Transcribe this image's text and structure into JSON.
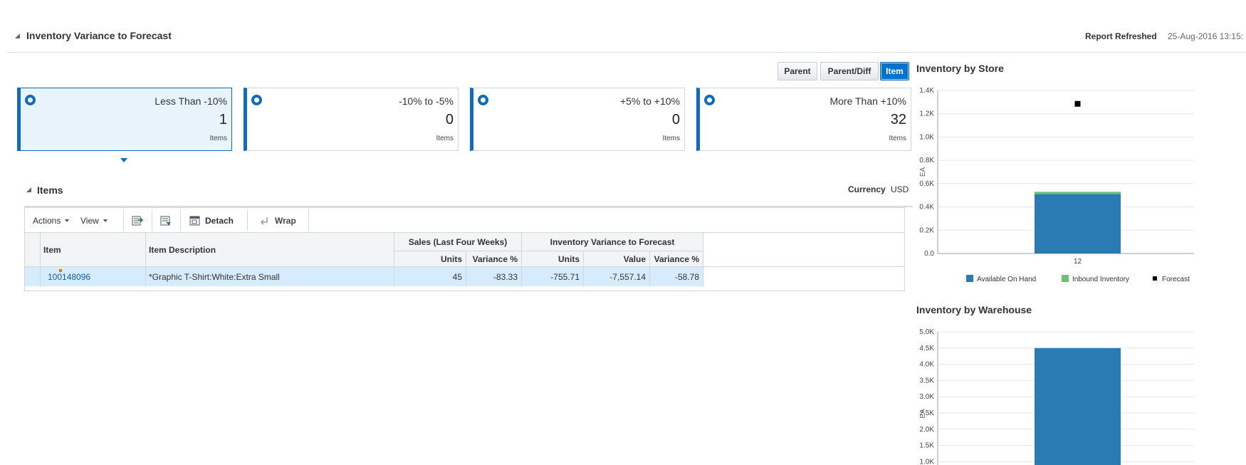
{
  "header": {
    "title": "Inventory Variance to Forecast",
    "refresh_label": "Report Refreshed",
    "refresh_date": "25-Aug-2016 13:15:"
  },
  "view_buttons": [
    {
      "label": "Parent",
      "active": false
    },
    {
      "label": "Parent/Diff",
      "active": false
    },
    {
      "label": "Item",
      "active": true
    }
  ],
  "tiles": [
    {
      "label": "Less Than -10%",
      "count": "1",
      "unit": "Items",
      "selected": true
    },
    {
      "label": "-10% to -5%",
      "count": "0",
      "unit": "Items",
      "selected": false
    },
    {
      "label": "+5% to +10%",
      "count": "0",
      "unit": "Items",
      "selected": false
    },
    {
      "label": "More Than +10%",
      "count": "32",
      "unit": "Items",
      "selected": false
    }
  ],
  "items_panel": {
    "title": "Items",
    "currency_label": "Currency",
    "currency_value": "USD",
    "toolbar": {
      "actions": "Actions",
      "view": "View",
      "detach": "Detach",
      "wrap": "Wrap"
    },
    "columns": {
      "item": "Item",
      "description": "Item Description",
      "sales_group": "Sales (Last Four Weeks)",
      "sales_units": "Units",
      "sales_variance": "Variance %",
      "inv_group": "Inventory Variance to Forecast",
      "inv_units": "Units",
      "inv_value": "Value",
      "inv_variance": "Variance %"
    },
    "rows": [
      {
        "item": "100148096",
        "description": "*Graphic T-Shirt:White:Extra Small",
        "sales_units": "45",
        "sales_variance": "-83.33",
        "inv_units": "-755.71",
        "inv_value": "-7,557.14",
        "inv_variance": "-58.78"
      }
    ]
  },
  "colors": {
    "accent": "#0f6cbd",
    "available_on_hand": "#2a7ab4",
    "inbound_inventory": "#6cc17a",
    "forecast": "#000000"
  },
  "chart_data": [
    {
      "type": "bar",
      "title": "Inventory by Store",
      "categories": [
        "12"
      ],
      "series": [
        {
          "name": "Available On Hand",
          "values": [
            510
          ]
        },
        {
          "name": "Inbound Inventory",
          "values": [
            20
          ]
        },
        {
          "name": "Forecast",
          "values": [
            1285
          ]
        }
      ],
      "ylabel": "EA",
      "ylim": [
        0,
        1400
      ],
      "yticks": [
        "0.0",
        "0.2K",
        "0.4K",
        "0.6K",
        "0.8K",
        "1.0K",
        "1.2K",
        "1.4K"
      ],
      "legend": "bottom",
      "grid": true
    },
    {
      "type": "bar",
      "title": "Inventory by Warehouse",
      "series": [
        {
          "name": "Available On Hand",
          "values": [
            4500
          ]
        }
      ],
      "ylabel": "EA",
      "ylim": [
        0,
        5000
      ],
      "yticks": [
        "1.0K",
        "1.5K",
        "2.0K",
        "2.5K",
        "3.0K",
        "3.5K",
        "4.0K",
        "4.5K",
        "5.0K"
      ],
      "grid": true
    }
  ]
}
